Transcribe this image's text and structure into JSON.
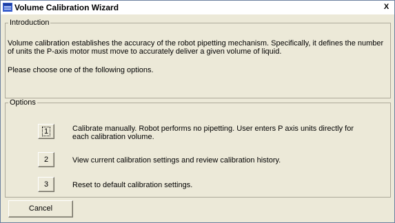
{
  "window": {
    "title": "Volume Calibration Wizard",
    "close_label": "X"
  },
  "introduction": {
    "legend": "Introduction",
    "text": "Volume calibration establishes the accuracy of the robot pipetting mechanism. Specifically, it defines the number of units the P-axis motor must move to accurately deliver a given volume of liquid.",
    "prompt": "Please choose one of the following options."
  },
  "options": {
    "legend": "Options",
    "items": [
      {
        "key": "1",
        "text": "Calibrate manually. Robot performs no pipetting. User enters P axis units directly for each calibration volume."
      },
      {
        "key": "2",
        "text": "View current calibration settings and review calibration history."
      },
      {
        "key": "3",
        "text": "Reset to default calibration settings."
      }
    ]
  },
  "footer": {
    "cancel_label": "Cancel"
  },
  "colors": {
    "face": "#ece9d8",
    "border": "#aca899",
    "icon": "#3a5fcd"
  },
  "icons": {
    "app": "app-window-icon",
    "close": "close-icon"
  }
}
